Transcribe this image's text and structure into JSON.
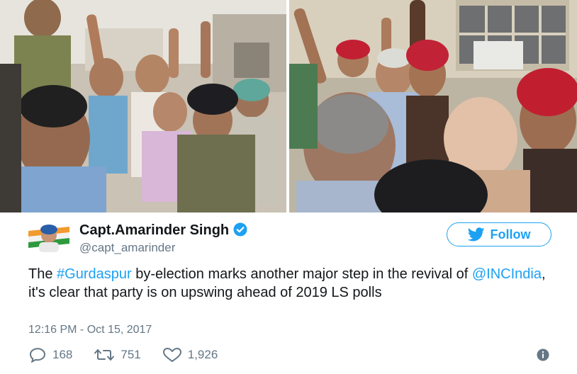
{
  "colors": {
    "accent": "#1da1f2",
    "text_primary": "#14171a",
    "text_secondary": "#657786"
  },
  "tweet": {
    "display_name": "Capt.Amarinder Singh",
    "handle": "@capt_amarinder",
    "verified_icon": "verified-badge-icon",
    "follow_label": "Follow",
    "text": {
      "part1": "The ",
      "hashtag": "#Gurdaspur",
      "part2": " by-election marks another major step in the revival of ",
      "mention": "@INCIndia",
      "part3": ", it's clear that party is on upswing ahead of 2019 LS polls"
    },
    "timestamp": "12:16 PM - Oct 15, 2017",
    "actions": {
      "replies": "168",
      "retweets": "751",
      "likes": "1,926"
    }
  }
}
